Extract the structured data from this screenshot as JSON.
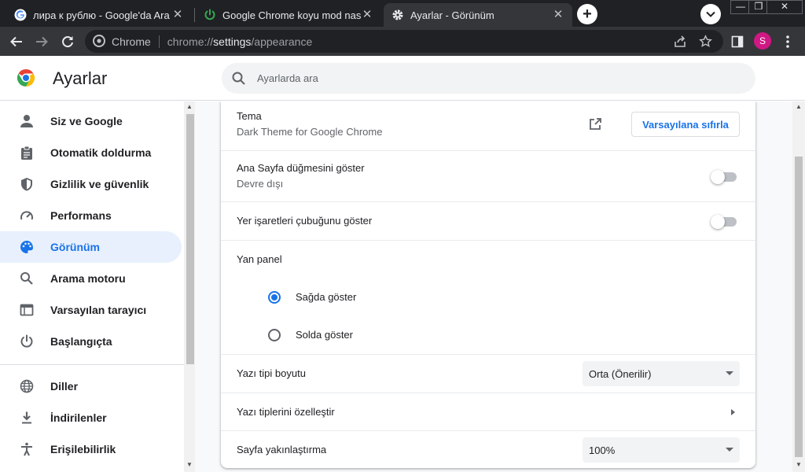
{
  "tabs": [
    {
      "title": "лира к рублю - Google'da Ara",
      "icon": "google-g-icon",
      "active": false
    },
    {
      "title": "Google Chrome koyu mod nasıl aç",
      "icon": "power-icon",
      "active": false
    },
    {
      "title": "Ayarlar - Görünüm",
      "icon": "gear-icon",
      "active": true
    }
  ],
  "window_controls": {
    "minimize": "—",
    "restore": "❐",
    "close": "✕"
  },
  "toolbar": {
    "site_label": "Chrome",
    "url_scheme": "chrome://",
    "url_host": "settings",
    "url_path": "/appearance",
    "avatar_letter": "S"
  },
  "header": {
    "title": "Ayarlar",
    "search_placeholder": "Ayarlarda ara"
  },
  "sidebar": {
    "items": [
      {
        "label": "Siz ve Google",
        "icon": "person-icon",
        "active": false
      },
      {
        "label": "Otomatik doldurma",
        "icon": "clipboard-icon",
        "active": false
      },
      {
        "label": "Gizlilik ve güvenlik",
        "icon": "shield-icon",
        "active": false
      },
      {
        "label": "Performans",
        "icon": "speedometer-icon",
        "active": false
      },
      {
        "label": "Görünüm",
        "icon": "palette-icon",
        "active": true
      },
      {
        "label": "Arama motoru",
        "icon": "search-icon",
        "active": false
      },
      {
        "label": "Varsayılan tarayıcı",
        "icon": "browser-window-icon",
        "active": false
      },
      {
        "label": "Başlangıçta",
        "icon": "power-icon",
        "active": false
      },
      {
        "label": "Diller",
        "icon": "globe-icon",
        "active": false
      },
      {
        "label": "İndirilenler",
        "icon": "download-icon",
        "active": false
      },
      {
        "label": "Erişilebilirlik",
        "icon": "accessibility-icon",
        "active": false
      }
    ]
  },
  "appearance": {
    "theme": {
      "label": "Tema",
      "value": "Dark Theme for Google Chrome",
      "reset_label": "Varsayılana sıfırla"
    },
    "home_button": {
      "label": "Ana Sayfa düğmesini göster",
      "sublabel": "Devre dışı",
      "enabled": false
    },
    "bookmarks_bar": {
      "label": "Yer işaretleri çubuğunu göster",
      "enabled": false
    },
    "side_panel": {
      "label": "Yan panel",
      "options": [
        {
          "label": "Sağda göster",
          "selected": true
        },
        {
          "label": "Solda göster",
          "selected": false
        }
      ]
    },
    "font_size": {
      "label": "Yazı tipi boyutu",
      "value": "Orta (Önerilir)"
    },
    "customize_fonts": {
      "label": "Yazı tiplerini özelleştir"
    },
    "page_zoom": {
      "label": "Sayfa yakınlaştırma",
      "value": "100%"
    }
  },
  "colors": {
    "accent": "#1a73e8",
    "active_nav_bg": "#e8f0fe",
    "tabstrip": "#202124",
    "toolbar": "#35363a",
    "avatar": "#d01884"
  }
}
